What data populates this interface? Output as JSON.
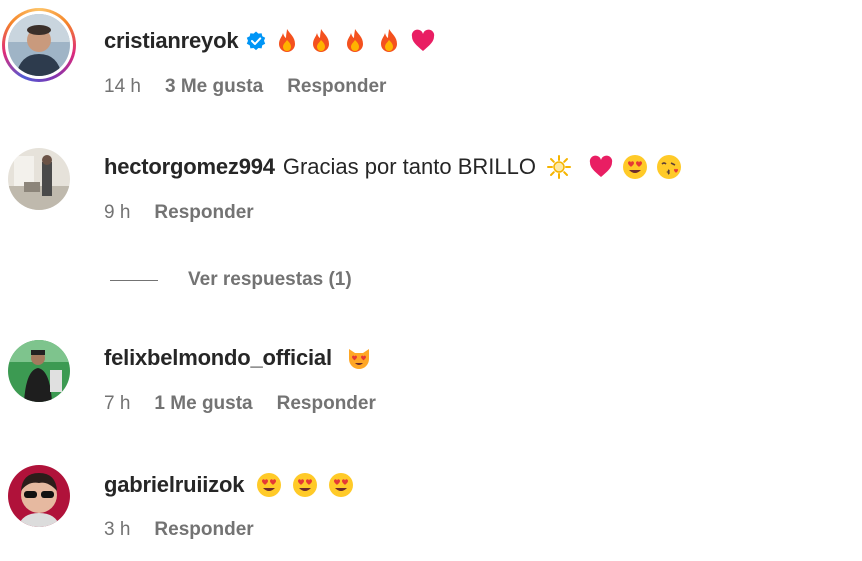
{
  "comments": [
    {
      "username": "cristianreyok",
      "verified": true,
      "text": "",
      "emojis": [
        "fire",
        "fire",
        "fire",
        "fire",
        "heart"
      ],
      "time": "14 h",
      "likes": "3 Me gusta",
      "reply_label": "Responder",
      "avatar": "avatar-cristianreyok"
    },
    {
      "username": "hectorgomez994",
      "verified": false,
      "text": "Gracias por tanto BRILLO",
      "emojis": [
        "sun",
        "heart",
        "heart-eyes",
        "kissing-face"
      ],
      "time": "9 h",
      "likes": "",
      "reply_label": "Responder",
      "view_replies_label": "Ver respuestas (1)",
      "avatar": "avatar-hectorgomez994"
    },
    {
      "username": "felixbelmondo_official",
      "verified": false,
      "text": "",
      "emojis": [
        "heart-eyes-cat"
      ],
      "time": "7 h",
      "likes": "1 Me gusta",
      "reply_label": "Responder",
      "avatar": "avatar-felixbelmondo"
    },
    {
      "username": "gabrielruiizok",
      "verified": false,
      "text": "",
      "emojis": [
        "heart-eyes",
        "heart-eyes",
        "heart-eyes"
      ],
      "time": "3 h",
      "likes": "",
      "reply_label": "Responder",
      "avatar": "avatar-gabrielruiizok"
    }
  ],
  "colors": {
    "verified_blue": "#0095f6",
    "meta_gray": "#737373",
    "text_dark": "#262626"
  }
}
